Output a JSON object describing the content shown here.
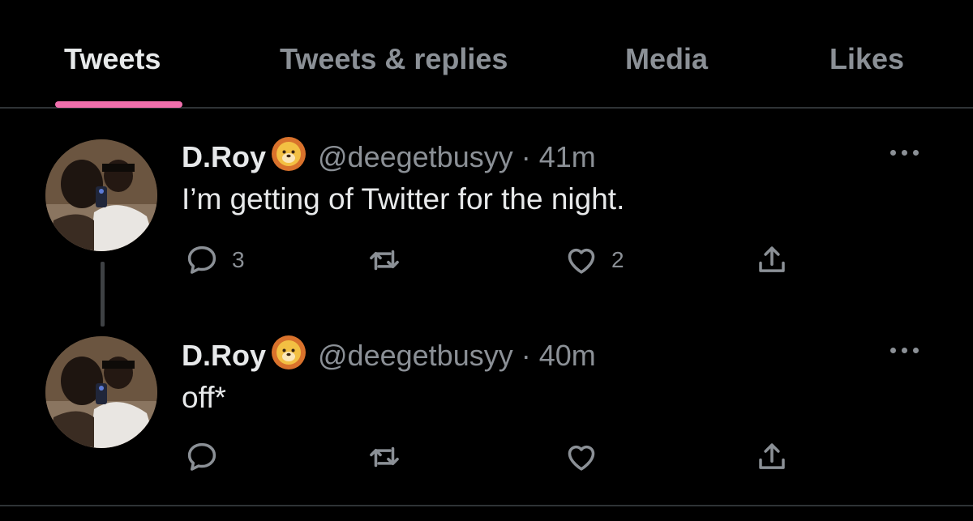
{
  "tabs": [
    {
      "label": "Tweets",
      "active": true
    },
    {
      "label": "Tweets & replies",
      "active": false
    },
    {
      "label": "Media",
      "active": false
    },
    {
      "label": "Likes",
      "active": false
    }
  ],
  "colors": {
    "tab_indicator": "#f06fad",
    "muted_text": "#8b9096",
    "primary_text": "#e7e9ea",
    "background": "#000000"
  },
  "tweets": [
    {
      "name": "D.Roy",
      "emoji": "lion-face",
      "handle": "@deegetbusyy",
      "separator": "·",
      "time": "41m",
      "text": "I’m getting of Twitter for the night.",
      "actions": {
        "reply": "3",
        "retweet": "",
        "like": "2",
        "share": ""
      }
    },
    {
      "name": "D.Roy",
      "emoji": "lion-face",
      "handle": "@deegetbusyy",
      "separator": "·",
      "time": "40m",
      "text": "off*",
      "actions": {
        "reply": "",
        "retweet": "",
        "like": "",
        "share": ""
      }
    }
  ]
}
